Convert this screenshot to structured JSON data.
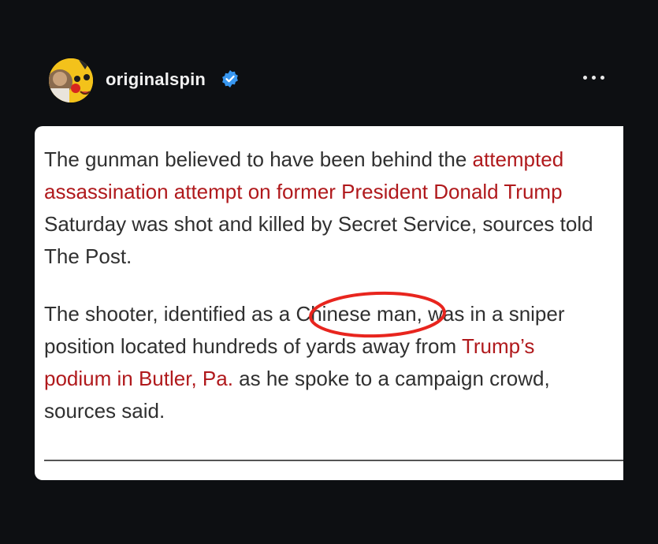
{
  "post": {
    "username": "originalspin",
    "verified_icon": "verified-badge-icon",
    "more_icon": "more-options-icon",
    "accent_color": "#3897f0"
  },
  "article": {
    "link_color": "#b0191c",
    "paragraph1": {
      "line1_text": "The gunman believed to have been behind the ",
      "line1_link": "attempted",
      "line2_link": "assassination attempt on former President Donald Trump",
      "line3_text": "Saturday was shot and killed by Secret Service, sources told",
      "line4_text": "The Post."
    },
    "paragraph2": {
      "line1_pre": "The shooter, identified as a ",
      "line1_circled": "Chinese man",
      "line1_post": ", was in a sniper",
      "line2_text": "position located hundreds of yards away from ",
      "line2_link": "Trump’s",
      "line3_link": "podium in Butler, Pa.",
      "line3_text": " as he spoke to a campaign crowd,",
      "line4_text": "sources said."
    },
    "annotation_color": "#e8251e"
  }
}
